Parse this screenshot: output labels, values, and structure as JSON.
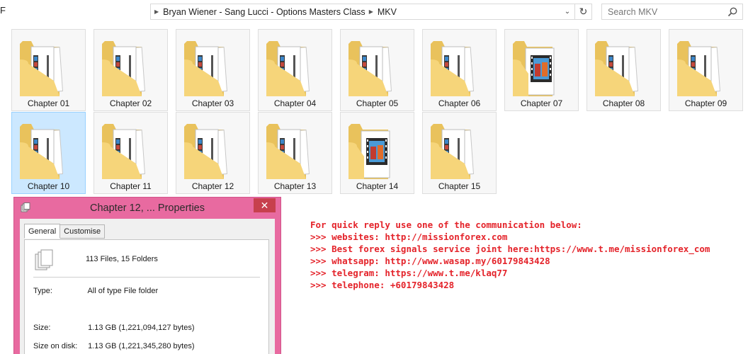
{
  "window": {
    "title_fragment": "F"
  },
  "address_bar": {
    "crumbs": [
      "Bryan Wiener - Sang Lucci - Options Masters Class",
      "MKV"
    ]
  },
  "search": {
    "placeholder": "Search MKV"
  },
  "folders": [
    {
      "label": "Chapter 01",
      "selected": false,
      "thumb": "film"
    },
    {
      "label": "Chapter 02",
      "selected": false,
      "thumb": "film"
    },
    {
      "label": "Chapter 03",
      "selected": false,
      "thumb": "film"
    },
    {
      "label": "Chapter 04",
      "selected": false,
      "thumb": "film"
    },
    {
      "label": "Chapter 05",
      "selected": false,
      "thumb": "film"
    },
    {
      "label": "Chapter 06",
      "selected": false,
      "thumb": "film"
    },
    {
      "label": "Chapter 07",
      "selected": false,
      "thumb": "video"
    },
    {
      "label": "Chapter 08",
      "selected": false,
      "thumb": "film"
    },
    {
      "label": "Chapter 09",
      "selected": false,
      "thumb": "film"
    },
    {
      "label": "Chapter 10",
      "selected": true,
      "thumb": "film"
    },
    {
      "label": "Chapter 11",
      "selected": false,
      "thumb": "film"
    },
    {
      "label": "Chapter 12",
      "selected": false,
      "thumb": "film"
    },
    {
      "label": "Chapter 13",
      "selected": false,
      "thumb": "film"
    },
    {
      "label": "Chapter 14",
      "selected": false,
      "thumb": "video"
    },
    {
      "label": "Chapter 15",
      "selected": false,
      "thumb": "film"
    }
  ],
  "properties_dialog": {
    "title": "Chapter 12, ... Properties",
    "close_glyph": "✕",
    "tabs": [
      "General",
      "Customise"
    ],
    "summary": "113 Files, 15 Folders",
    "type_label": "Type:",
    "type_value": "All of type File folder",
    "size_label": "Size:",
    "size_value": "1.13 GB (1,221,094,127 bytes)",
    "size_on_disk_label": "Size on disk:",
    "size_on_disk_value": "1.13 GB (1,221,345,280 bytes)"
  },
  "notice": {
    "lines": [
      "For quick reply use one of the communication below:",
      ">>> websites: http://missionforex.com",
      ">>> Best forex signals service joint here:https://www.t.me/missionforex_com",
      ">>> whatsapp: http://www.wasap.my/60179843428",
      ">>> telegram: https://www.t.me/klaq77",
      ">>> telephone: +60179843428"
    ],
    "color": "#e4232a"
  },
  "colors": {
    "selection_bg": "#cce8ff",
    "dialog_frame": "#e86aa0",
    "close_button": "#c7404d",
    "folder_yellow": "#f6d57a"
  }
}
